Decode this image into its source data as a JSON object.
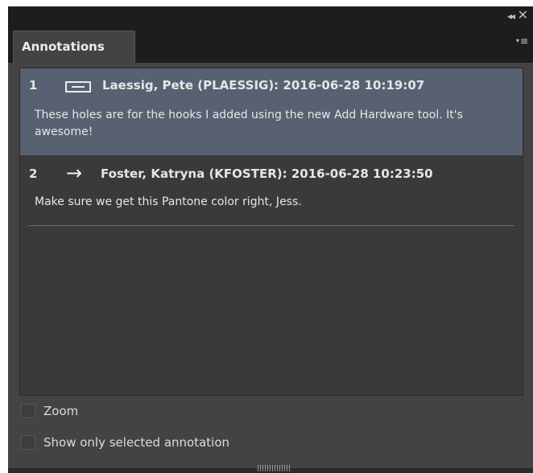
{
  "panel": {
    "collapse_icon": "◂◂",
    "close_icon": "✕",
    "tab_label": "Annotations",
    "menu_icon": "≡"
  },
  "annotations": [
    {
      "number": "1",
      "icon": "rectangle-icon",
      "author": "Laessig, Pete (PLAESSIG): 2016-06-28 10:19:07",
      "body": "These holes are for the hooks I added using the new Add Hardware tool. It's awesome!",
      "selected": true
    },
    {
      "number": "2",
      "icon": "arrow-right-icon",
      "author": "Foster, Katryna (KFOSTER): 2016-06-28 10:23:50",
      "body": "Make sure we get this Pantone color right, Jess.",
      "selected": false
    }
  ],
  "options": {
    "zoom_label": "Zoom",
    "show_selected_label": "Show only selected annotation"
  },
  "colors": {
    "panel_bg": "#434343",
    "header_bg": "#1d1d1d",
    "list_bg": "#3a3a3a",
    "selected_bg": "#576171"
  }
}
